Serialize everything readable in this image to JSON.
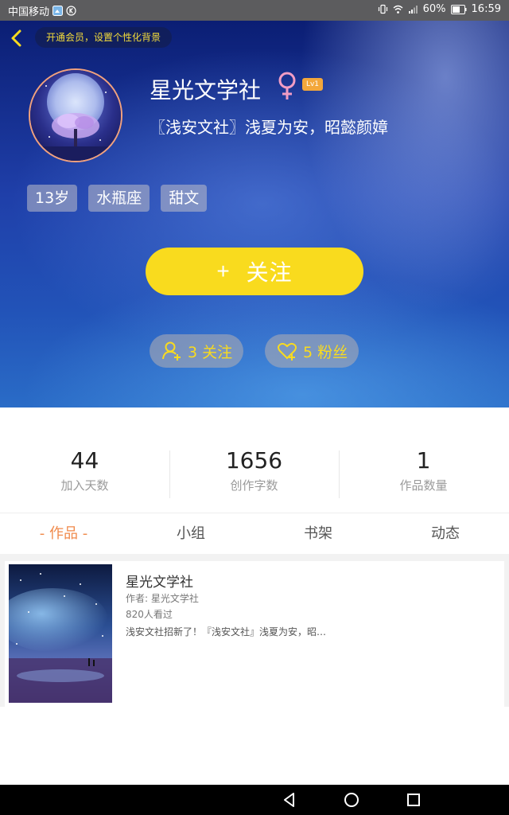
{
  "status_bar": {
    "carrier": "中国移动",
    "battery": "60%",
    "time": "16:59"
  },
  "header": {
    "back_icon": "chevron-left-icon",
    "vip_prompt": "开通会员，设置个性化背景"
  },
  "profile": {
    "name": "星光文学社",
    "gender_icon": "female-icon",
    "level": "Lv1",
    "signature": "〖浅安文社〗浅夏为安，昭懿颜嫜",
    "tags": [
      "13岁",
      "水瓶座",
      "甜文"
    ],
    "follow_button": {
      "icon": "+",
      "label": "关注"
    },
    "following": "3 关注",
    "fans": "5 粉丝"
  },
  "stats": [
    {
      "value": "44",
      "label": "加入天数"
    },
    {
      "value": "1656",
      "label": "创作字数"
    },
    {
      "value": "1",
      "label": "作品数量"
    }
  ],
  "tabs": [
    {
      "label": "- 作品 -",
      "active": true
    },
    {
      "label": "小组",
      "active": false
    },
    {
      "label": "书架",
      "active": false
    },
    {
      "label": "动态",
      "active": false
    }
  ],
  "works": [
    {
      "title": "星光文学社",
      "author": "作者: 星光文学社",
      "views": "820人看过",
      "description": "浅安文社招新了！『浅安文社』浅夏为安，昭…"
    }
  ],
  "colors": {
    "accent_yellow": "#f9db1e",
    "active_tab": "#f08a4b",
    "level_badge": "#f3a73b"
  }
}
